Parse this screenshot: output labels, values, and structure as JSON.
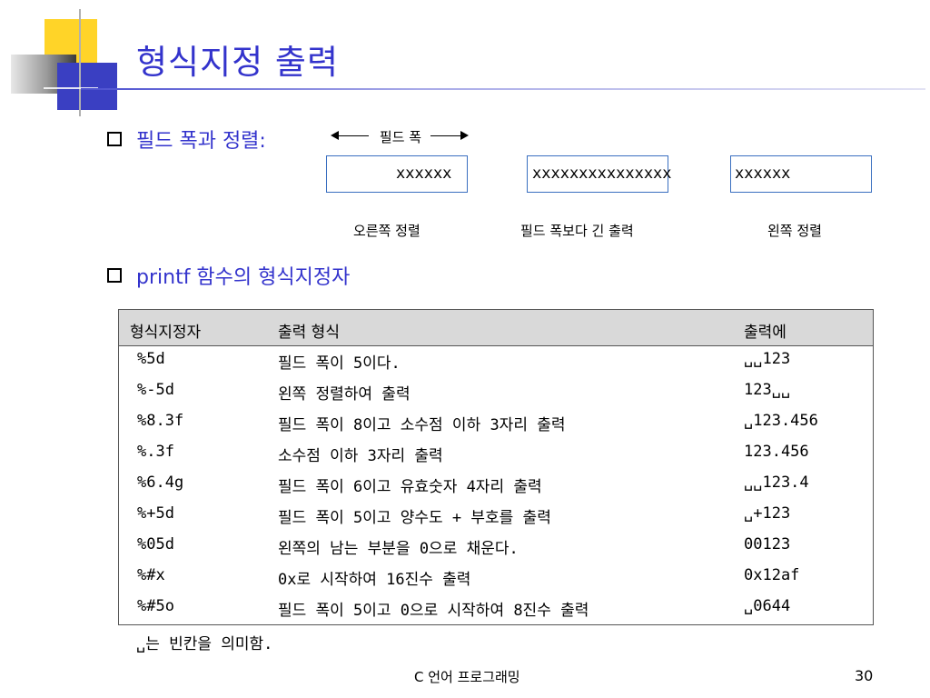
{
  "slide": {
    "title": "형식지정 출력",
    "bullets": [
      {
        "text": "필드 폭과 정렬:"
      },
      {
        "text": "printf 함수의 형식지정자"
      }
    ],
    "field_width_label": "필드 폭",
    "field_boxes": [
      {
        "text": "xxxxxx",
        "caption": "오른쪽 정렬"
      },
      {
        "text": "xxxxxxxxxxxxxxx",
        "caption": "필드 폭보다 긴 출력"
      },
      {
        "text": "xxxxxx",
        "caption": "왼쪽 정렬"
      }
    ],
    "table": {
      "headers": [
        "형식지정자",
        "출력 형식",
        "출력에"
      ],
      "rows": [
        [
          "%5d",
          "필드 폭이 5이다.",
          "␣␣123"
        ],
        [
          "%-5d",
          "왼쪽 정렬하여 출력",
          "123␣␣"
        ],
        [
          "%8.3f",
          "필드 폭이 8이고 소수점 이하 3자리 출력",
          "␣123.456"
        ],
        [
          "%.3f",
          "소수점 이하 3자리 출력",
          "123.456"
        ],
        [
          "%6.4g",
          "필드 폭이 6이고 유효숫자 4자리 출력",
          "␣␣123.4"
        ],
        [
          "%+5d",
          "필드 폭이 5이고 양수도 + 부호를 출력",
          "␣+123"
        ],
        [
          "%05d",
          "왼쪽의 남는 부분을 0으로 채운다.",
          "00123"
        ],
        [
          "%#x",
          "0x로 시작하여 16진수 출력",
          "0x12af"
        ],
        [
          "%#5o",
          "필드 폭이 5이고 0으로 시작하여 8진수 출력",
          "␣0644"
        ]
      ]
    },
    "note": "␣는 빈칸을 의미함.",
    "footer": "C 언어 프로그래밍",
    "page_number": "30"
  },
  "colors": {
    "title": "#3333cc",
    "box_border": "#3a6fc0",
    "table_header_bg": "#d9d9d9"
  },
  "icons": [
    "checkbox-bullet-icon",
    "left-arrow-icon",
    "right-arrow-icon"
  ]
}
